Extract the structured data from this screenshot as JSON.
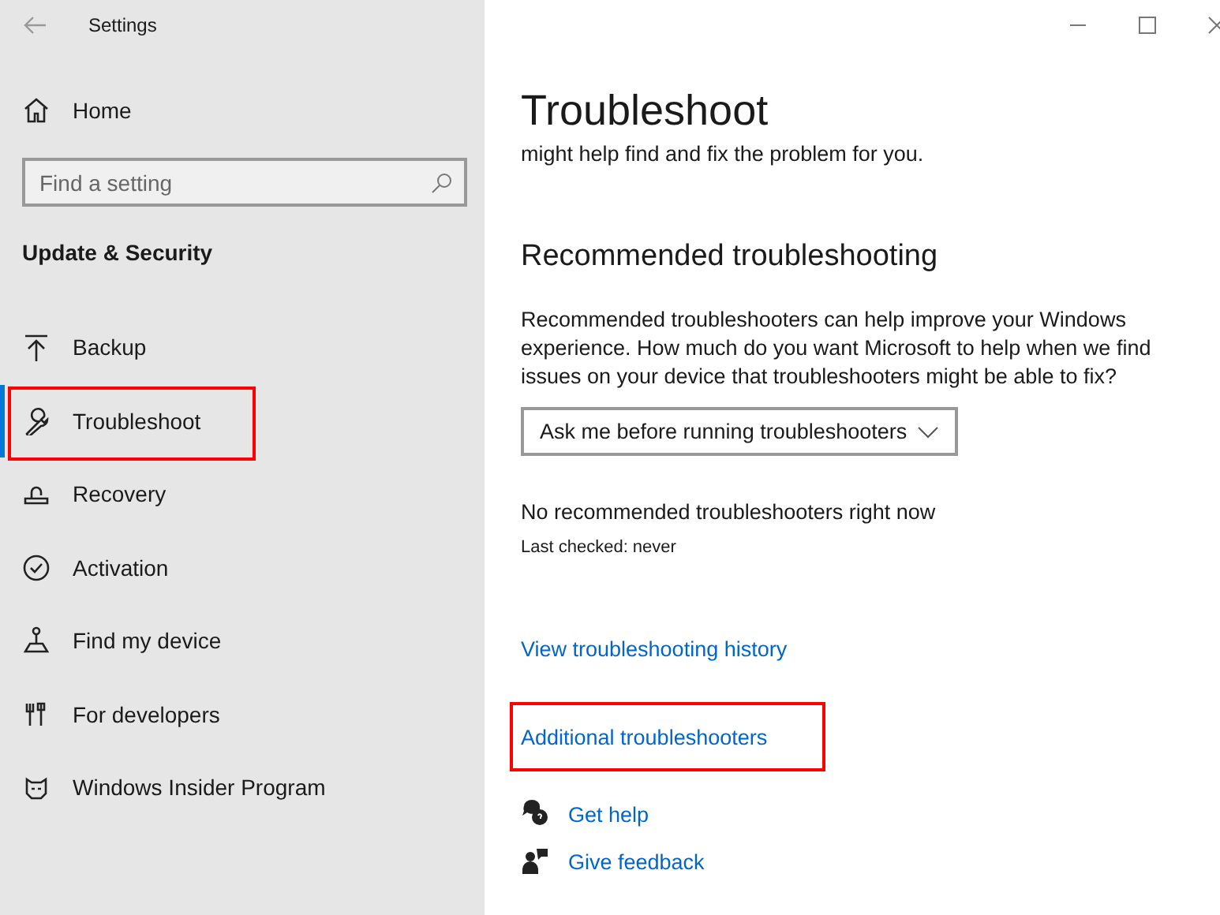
{
  "window": {
    "title": "Settings"
  },
  "sidebar": {
    "home": "Home",
    "search": {
      "placeholder": "Find a setting"
    },
    "section": "Update & Security",
    "items": [
      {
        "label": "Backup",
        "selected": false,
        "highlighted": false
      },
      {
        "label": "Troubleshoot",
        "selected": true,
        "highlighted": true
      },
      {
        "label": "Recovery",
        "selected": false,
        "highlighted": false
      },
      {
        "label": "Activation",
        "selected": false,
        "highlighted": false
      },
      {
        "label": "Find my device",
        "selected": false,
        "highlighted": false
      },
      {
        "label": "For developers",
        "selected": false,
        "highlighted": false
      },
      {
        "label": "Windows Insider Program",
        "selected": false,
        "highlighted": false
      }
    ]
  },
  "content": {
    "title": "Troubleshoot",
    "intro": "might help find and fix the problem for you.",
    "heading": "Recommended troubleshooting",
    "description": "Recommended troubleshooters can help improve your Windows experience. How much do you want Microsoft to help when we find issues on your device that troubleshooters might be able to fix?",
    "dropdown": {
      "value": "Ask me before running troubleshooters"
    },
    "status": "No recommended troubleshooters right now",
    "last_checked": "Last checked: never",
    "links": [
      {
        "label": "View troubleshooting history",
        "highlighted": false
      },
      {
        "label": "Additional troubleshooters",
        "highlighted": true
      }
    ],
    "help": [
      {
        "label": "Get help"
      },
      {
        "label": "Give feedback"
      }
    ]
  }
}
